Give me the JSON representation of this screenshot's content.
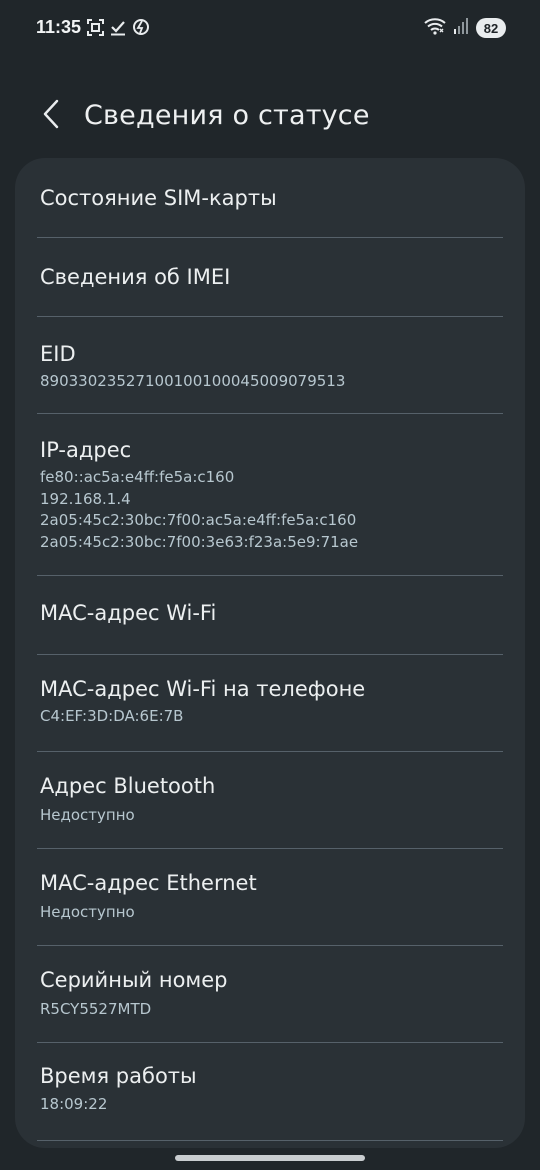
{
  "status_bar": {
    "time": "11:35",
    "battery": "82",
    "icons_left": [
      "scan-icon",
      "download-done-icon",
      "data-saver-icon"
    ],
    "icons_right": [
      "wifi-icon",
      "signal-icon",
      "battery-icon"
    ]
  },
  "header": {
    "title": "Сведения о статусе",
    "back_icon": "chevron-left-icon"
  },
  "items": [
    {
      "label": "Состояние SIM-карты",
      "value": ""
    },
    {
      "label": "Сведения об IMEI",
      "value": ""
    },
    {
      "label": "EID",
      "value": "89033023527100100100045009079513"
    },
    {
      "label": "IP-адрес",
      "value": "fe80::ac5a:e4ff:fe5a:c160\n192.168.1.4\n2a05:45c2:30bc:7f00:ac5a:e4ff:fe5a:c160\n2a05:45c2:30bc:7f00:3e63:f23a:5e9:71ae"
    },
    {
      "label": "MAC-адрес Wi-Fi",
      "value": ""
    },
    {
      "label": "MAC-адрес Wi-Fi на телефоне",
      "value": "C4:EF:3D:DA:6E:7B"
    },
    {
      "label": "Адрес Bluetooth",
      "value": "Недоступно"
    },
    {
      "label": "MAC-адрес Ethernet",
      "value": "Недоступно"
    },
    {
      "label": "Серийный номер",
      "value": "R5CY5527MTD"
    },
    {
      "label": "Время работы",
      "value": "18:09:22"
    }
  ],
  "colors": {
    "background": "#20262a",
    "card": "#2a3136",
    "value_text": "#b7c7cf",
    "divider": "#56616a"
  }
}
